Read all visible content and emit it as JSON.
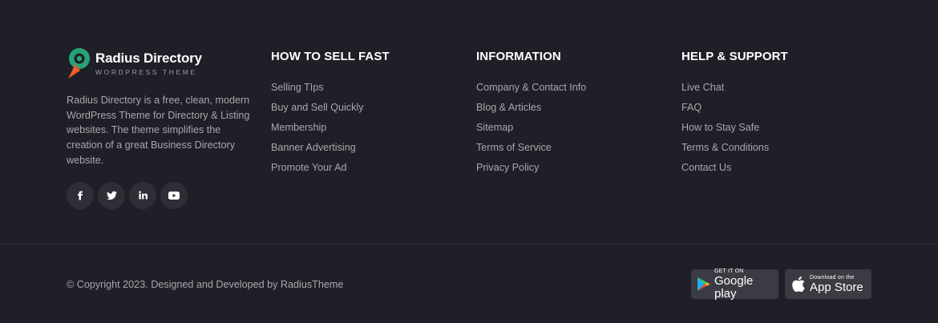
{
  "brand": {
    "title": "Radius Directory",
    "subtitle": "WORDPRESS THEME",
    "description": "Radius Directory is a free, clean, modern WordPress Theme for Directory & Listing websites. The theme simplifies the creation of a great Business Directory website.",
    "colors": {
      "mark_green": "#27a376",
      "mark_orange": "#f15a29"
    }
  },
  "socials": [
    {
      "name": "facebook-icon"
    },
    {
      "name": "twitter-icon"
    },
    {
      "name": "linkedin-icon"
    },
    {
      "name": "youtube-icon"
    }
  ],
  "columns": [
    {
      "title": "HOW TO SELL FAST",
      "links": [
        "Selling TIps",
        "Buy and Sell Quickly",
        "Membership",
        "Banner Advertising",
        "Promote Your Ad"
      ]
    },
    {
      "title": "INFORMATION",
      "links": [
        "Company & Contact Info",
        "Blog & Articles",
        "Sitemap",
        "Terms of Service",
        "Privacy Policy"
      ]
    },
    {
      "title": "HELP & SUPPORT",
      "links": [
        "Live Chat",
        "FAQ",
        "How to Stay Safe",
        "Terms & Conditions",
        "Contact Us"
      ]
    }
  ],
  "bottom": {
    "copyright": "© Copyright 2023. Designed and Developed by RadiusTheme",
    "google_play": {
      "small": "GET IT ON",
      "big": "Google play"
    },
    "app_store": {
      "small": "Download on the",
      "big": "App Store"
    }
  }
}
